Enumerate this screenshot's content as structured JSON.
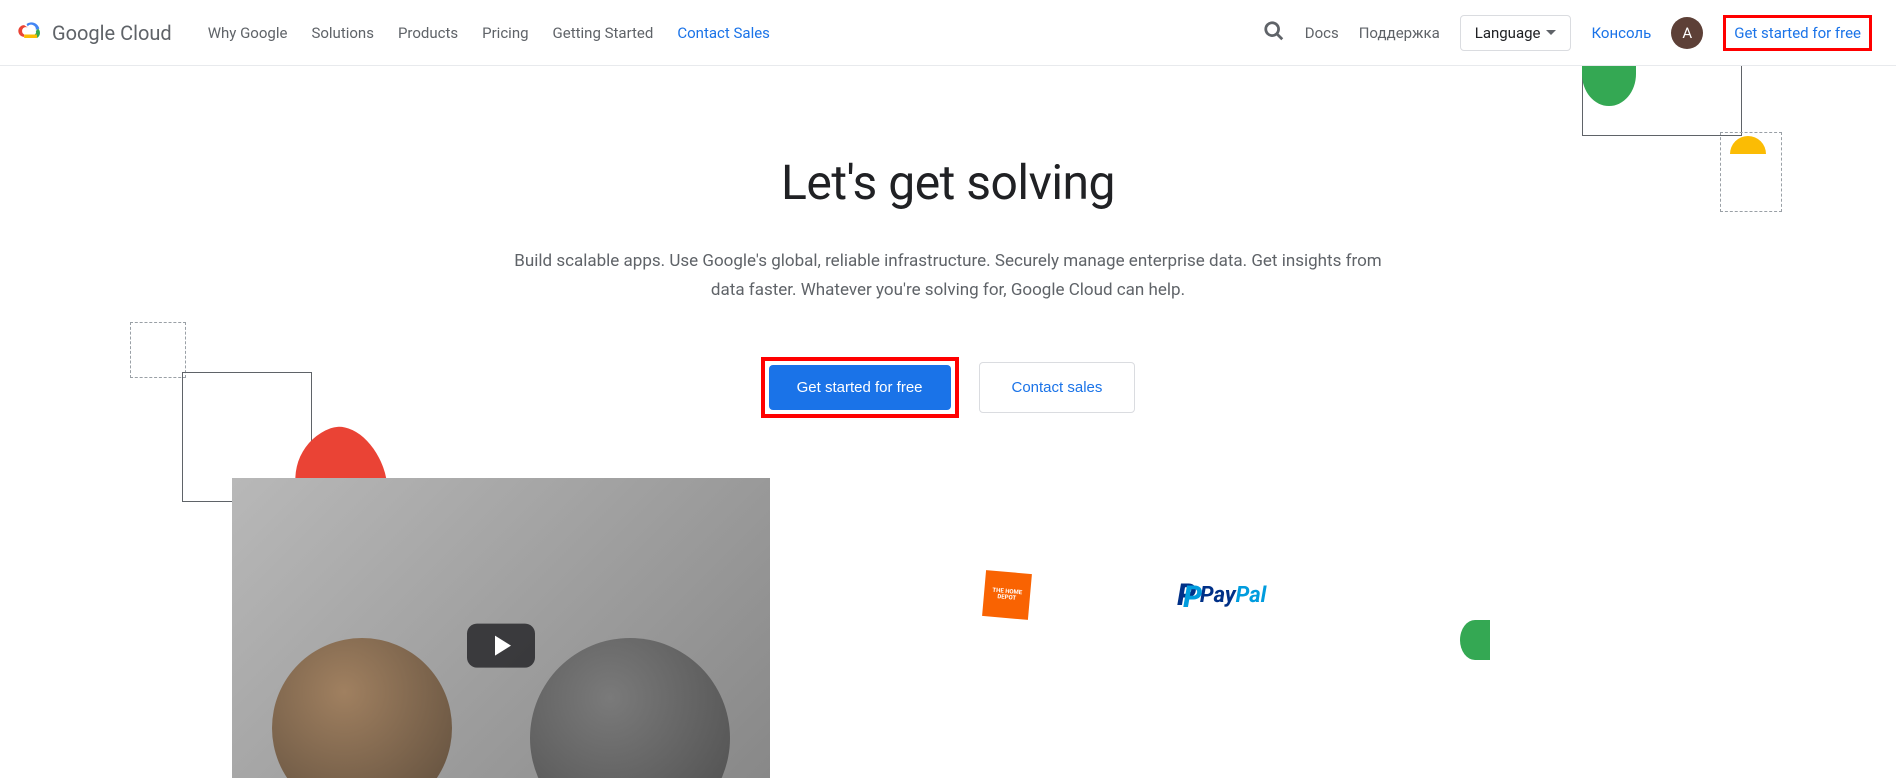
{
  "brand": "Google Cloud",
  "nav": {
    "items": [
      {
        "label": "Why Google"
      },
      {
        "label": "Solutions"
      },
      {
        "label": "Products"
      },
      {
        "label": "Pricing"
      },
      {
        "label": "Getting Started"
      },
      {
        "label": "Contact Sales"
      }
    ]
  },
  "rightNav": {
    "docs": "Docs",
    "support": "Поддержка",
    "language": "Language",
    "console": "Консоль",
    "avatarLetter": "A",
    "headerCta": "Get started for free"
  },
  "hero": {
    "title": "Let's get solving",
    "subtitle": "Build scalable apps. Use Google's global, reliable infrastructure. Securely manage enterprise data. Get insights from data faster. Whatever you're solving for, Google Cloud can help.",
    "primaryCta": "Get started for free",
    "secondaryCta": "Contact sales"
  },
  "partners": {
    "homeDepot": "THE HOME DEPOT",
    "paypalPay": "Pay",
    "paypalPal": "Pal"
  },
  "colors": {
    "accent": "#1a73e8",
    "highlight": "#ff0000"
  }
}
